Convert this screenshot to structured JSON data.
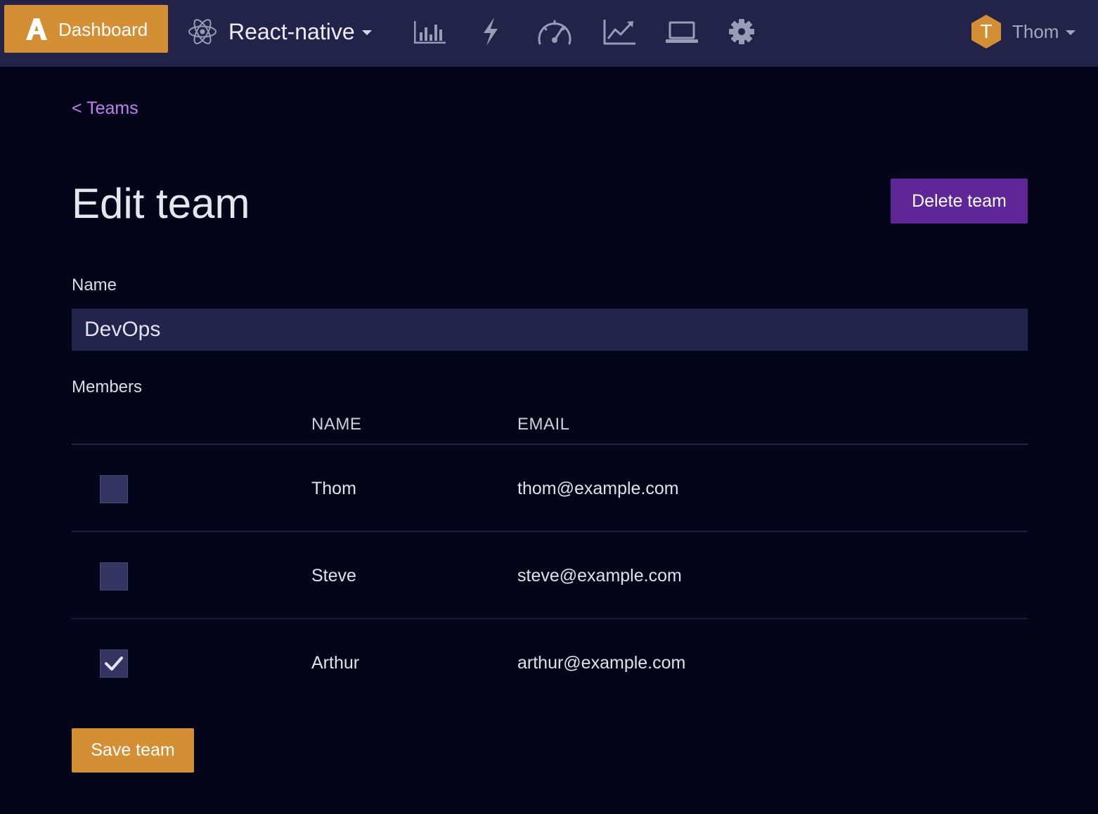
{
  "nav": {
    "dashboard_label": "Dashboard",
    "project_label": "React-native",
    "icons": [
      "bar-chart-icon",
      "bolt-icon",
      "gauge-icon",
      "line-chart-icon",
      "laptop-icon",
      "gear-icon"
    ],
    "user_initial": "T",
    "user_name": "Thom"
  },
  "breadcrumb": "< Teams",
  "page": {
    "title": "Edit team",
    "delete_label": "Delete team"
  },
  "form": {
    "name_label": "Name",
    "name_value": "DevOps",
    "members_label": "Members"
  },
  "table": {
    "columns": [
      "NAME",
      "EMAIL"
    ],
    "rows": [
      {
        "name": "Thom",
        "email": "thom@example.com",
        "checked": false
      },
      {
        "name": "Steve",
        "email": "steve@example.com",
        "checked": false
      },
      {
        "name": "Arthur",
        "email": "arthur@example.com",
        "checked": true
      }
    ]
  },
  "save_label": "Save team",
  "colors": {
    "accent": "#d48f35",
    "topbar": "#232249",
    "background": "#05051a",
    "danger": "#5f2698",
    "link": "#c27ff0"
  }
}
